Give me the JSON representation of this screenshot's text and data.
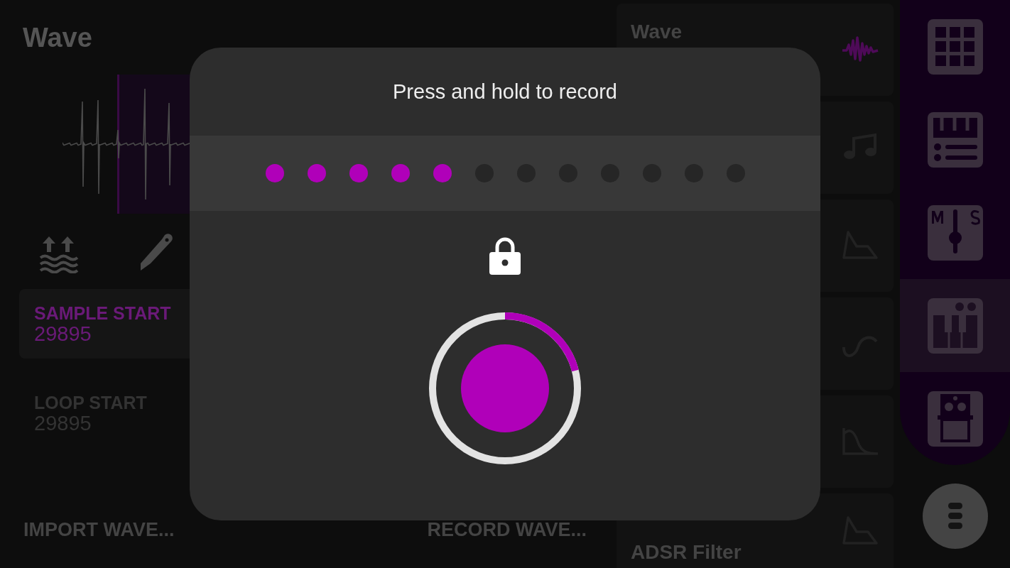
{
  "editor": {
    "title": "Wave",
    "fields": [
      {
        "label": "SAMPLE START",
        "value": "29895",
        "selected": true
      },
      {
        "label": "LOOP START",
        "value": "29895",
        "selected": false
      }
    ],
    "actions": [
      "IMPORT WAVE...",
      "RECORD WAVE..."
    ]
  },
  "modules": [
    {
      "name": "Wave",
      "kind": "wave",
      "selected": true
    },
    {
      "kind": "note",
      "selected": false
    },
    {
      "kind": "envelope",
      "selected": false
    },
    {
      "kind": "curve",
      "selected": false
    },
    {
      "kind": "filter",
      "selected": false
    },
    {
      "name": "ADSR Filter",
      "kind": "envelope",
      "selected": false
    }
  ],
  "nav": [
    {
      "kind": "grid",
      "selected": false
    },
    {
      "kind": "sequencer",
      "selected": false
    },
    {
      "kind": "mixer",
      "selected": false
    },
    {
      "kind": "piano",
      "selected": true
    },
    {
      "kind": "pedal",
      "selected": false
    }
  ],
  "dialog": {
    "title": "Press and hold to record",
    "steps": [
      {
        "filled": true
      },
      {
        "filled": true
      },
      {
        "filled": true
      },
      {
        "filled": true
      },
      {
        "filled": true
      },
      {
        "filled": false
      },
      {
        "filled": false
      },
      {
        "filled": false
      },
      {
        "filled": false
      },
      {
        "filled": false
      },
      {
        "filled": false
      },
      {
        "filled": false
      }
    ],
    "record_button": {
      "level": 0.21
    }
  }
}
